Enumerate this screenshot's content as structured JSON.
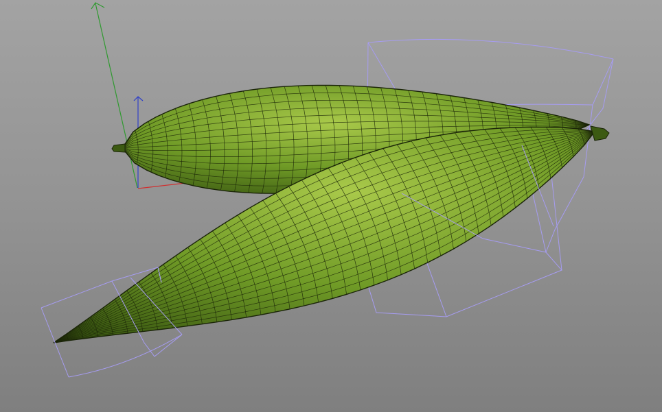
{
  "viewport": {
    "kind": "3d-viewport",
    "background": {
      "top": "#a3a3a3",
      "middle": "#939393",
      "bottom": "#7f7f7f"
    }
  },
  "axes": {
    "x_color": "#d03030",
    "y_color": "#2f9a2f",
    "z_color": "#2f3fc8"
  },
  "objects": [
    {
      "id": "luffa-upper",
      "kind": "mesh",
      "display": "wireframe-on-shaded",
      "color_light": "#a9c94a",
      "color_mid": "#6f9a26",
      "color_dark": "#3c5a12",
      "wire_color": "#1a2408"
    },
    {
      "id": "luffa-lower",
      "kind": "mesh",
      "display": "wireframe-on-shaded",
      "color_light": "#a9c94a",
      "color_mid": "#6f9a26",
      "color_dark": "#3c5a12",
      "wire_color": "#1a2408"
    }
  ],
  "deformers": {
    "cage_color": "#a69cf2",
    "count": 2
  }
}
